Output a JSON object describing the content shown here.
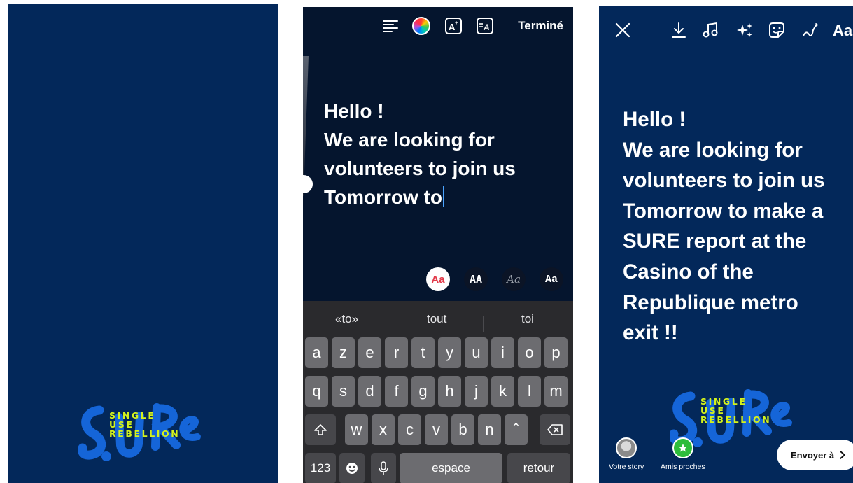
{
  "logo": {
    "brand": "S.U.Re",
    "lines": [
      "SINGLE",
      "USE",
      "REBELLION"
    ]
  },
  "editor": {
    "done_label": "Terminé",
    "icons": [
      "align-left-icon",
      "color-wheel-icon",
      "text-effect-icon",
      "text-background-icon"
    ],
    "text_lines": [
      "Hello !",
      "We are looking for",
      "volunteers to join us",
      "Tomorrow to"
    ],
    "font_styles": [
      "Aa",
      "AA",
      "Aa",
      "Aa"
    ]
  },
  "keyboard": {
    "suggestions": [
      "«to»",
      "tout",
      "toi"
    ],
    "row1": [
      "a",
      "z",
      "e",
      "r",
      "t",
      "y",
      "u",
      "i",
      "o",
      "p"
    ],
    "row2": [
      "q",
      "s",
      "d",
      "f",
      "g",
      "h",
      "j",
      "k",
      "l",
      "m"
    ],
    "row3": [
      "w",
      "x",
      "c",
      "v",
      "b",
      "n",
      "ˆ"
    ],
    "numbers_label": "123",
    "space_label": "espace",
    "return_label": "retour"
  },
  "story": {
    "text_lines": [
      "Hello !",
      "We are looking for",
      "volunteers to join us",
      "Tomorrow to make a",
      "SURE report at the",
      "Casino of the",
      "Republique metro",
      "exit !!"
    ],
    "toolbar_icons": [
      "close-icon",
      "download-icon",
      "music-icon",
      "effects-icon",
      "sticker-icon",
      "draw-icon"
    ],
    "text_tool": "Aa",
    "your_story_label": "Votre story",
    "close_friends_label": "Amis proches",
    "send_label": "Envoyer à"
  },
  "colors": {
    "panel_blue": "#03285a",
    "editor_bg": "#05152e",
    "logo_blue": "#1565d8",
    "logo_green": "#d4f21c",
    "close_friends_green": "#2ebd3b"
  }
}
